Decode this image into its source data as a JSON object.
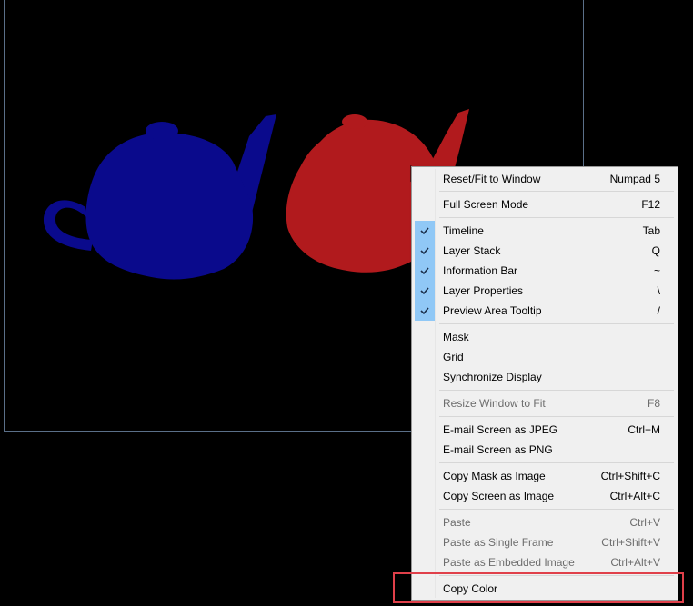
{
  "scene": {
    "colors": {
      "background": "#000000",
      "teapot_blue": "#0a0a8c",
      "teapot_red": "#b11a1d",
      "frame": "#5a6f88",
      "menu_bg": "#f0f0f0",
      "check_bg": "#90c8f6",
      "highlight": "#e0404a"
    },
    "objects": [
      "blue-teapot",
      "red-teapot"
    ]
  },
  "context_menu": {
    "items": [
      {
        "label": "Reset/Fit to Window",
        "shortcut": "Numpad 5",
        "checked": false,
        "enabled": true
      },
      {
        "label": "Full Screen Mode",
        "shortcut": "F12",
        "checked": false,
        "enabled": true
      },
      {
        "label": "Timeline",
        "shortcut": "Tab",
        "checked": true,
        "enabled": true
      },
      {
        "label": "Layer Stack",
        "shortcut": "Q",
        "checked": true,
        "enabled": true
      },
      {
        "label": "Information Bar",
        "shortcut": "~",
        "checked": true,
        "enabled": true
      },
      {
        "label": "Layer Properties",
        "shortcut": "\\",
        "checked": true,
        "enabled": true
      },
      {
        "label": "Preview Area Tooltip",
        "shortcut": "/",
        "checked": true,
        "enabled": true
      },
      {
        "label": "Mask",
        "shortcut": "",
        "checked": false,
        "enabled": true
      },
      {
        "label": "Grid",
        "shortcut": "",
        "checked": false,
        "enabled": true
      },
      {
        "label": "Synchronize Display",
        "shortcut": "",
        "checked": false,
        "enabled": true
      },
      {
        "label": "Resize Window to Fit",
        "shortcut": "F8",
        "checked": false,
        "enabled": false
      },
      {
        "label": "E-mail Screen as JPEG",
        "shortcut": "Ctrl+M",
        "checked": false,
        "enabled": true
      },
      {
        "label": "E-mail Screen as PNG",
        "shortcut": "",
        "checked": false,
        "enabled": true
      },
      {
        "label": "Copy Mask as Image",
        "shortcut": "Ctrl+Shift+C",
        "checked": false,
        "enabled": true
      },
      {
        "label": "Copy Screen as Image",
        "shortcut": "Ctrl+Alt+C",
        "checked": false,
        "enabled": true
      },
      {
        "label": "Paste",
        "shortcut": "Ctrl+V",
        "checked": false,
        "enabled": false
      },
      {
        "label": "Paste as Single Frame",
        "shortcut": "Ctrl+Shift+V",
        "checked": false,
        "enabled": false
      },
      {
        "label": "Paste as Embedded Image",
        "shortcut": "Ctrl+Alt+V",
        "checked": false,
        "enabled": false
      },
      {
        "label": "Copy Color",
        "shortcut": "",
        "checked": false,
        "enabled": true
      }
    ],
    "highlighted_item": "Copy Color"
  }
}
